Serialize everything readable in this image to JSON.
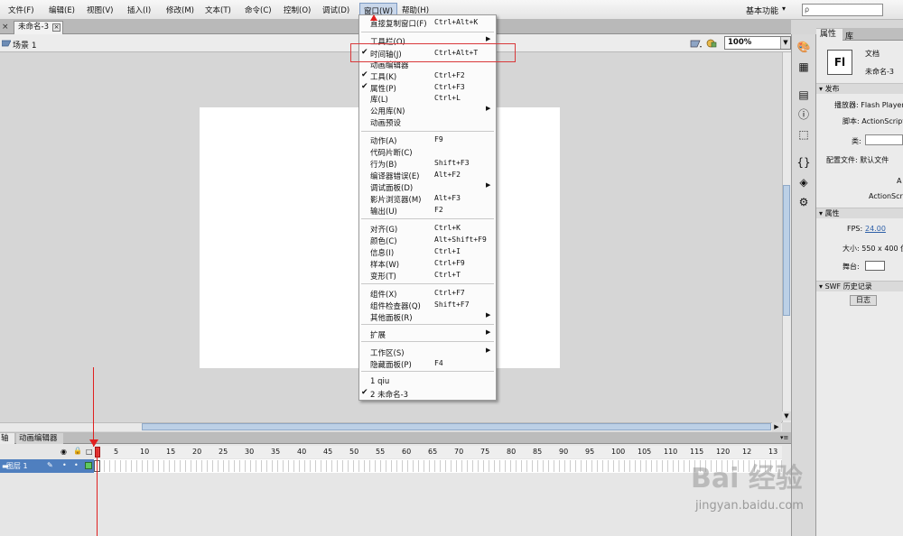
{
  "menubar": {
    "items": [
      {
        "label": "文件(F)"
      },
      {
        "label": "编辑(E)"
      },
      {
        "label": "视图(V)"
      },
      {
        "label": "插入(I)"
      },
      {
        "label": "修改(M)"
      },
      {
        "label": "文本(T)"
      },
      {
        "label": "命令(C)"
      },
      {
        "label": "控制(O)"
      },
      {
        "label": "调试(D)"
      },
      {
        "label": "窗口(W)"
      },
      {
        "label": "帮助(H)"
      }
    ],
    "workspace": "基本功能",
    "workspace_chevron": "▾",
    "search_icon": "ρ"
  },
  "document_tab": {
    "title": "未命名-3",
    "close": "×",
    "panel_close": "×"
  },
  "scene": {
    "label": "场景 1",
    "zoom": "100%"
  },
  "window_menu": {
    "items": [
      {
        "label": "直接复制窗口(F)",
        "shortcut": "Ctrl+Alt+K",
        "checked": false,
        "submenu": false
      },
      {
        "label": "工具栏(O)",
        "shortcut": "",
        "checked": false,
        "submenu": true
      },
      {
        "label": "时间轴(J)",
        "shortcut": "Ctrl+Alt+T",
        "checked": true,
        "submenu": false
      },
      {
        "label": "动画编辑器",
        "shortcut": "",
        "checked": false,
        "submenu": false
      },
      {
        "label": "工具(K)",
        "shortcut": "Ctrl+F2",
        "checked": true,
        "submenu": false
      },
      {
        "label": "属性(P)",
        "shortcut": "Ctrl+F3",
        "checked": true,
        "submenu": false
      },
      {
        "label": "库(L)",
        "shortcut": "Ctrl+L",
        "checked": false,
        "submenu": false
      },
      {
        "label": "公用库(N)",
        "shortcut": "",
        "checked": false,
        "submenu": true
      },
      {
        "label": "动画预设",
        "shortcut": "",
        "checked": false,
        "submenu": false
      },
      {
        "label": "动作(A)",
        "shortcut": "F9",
        "checked": false,
        "submenu": false
      },
      {
        "label": "代码片断(C)",
        "shortcut": "",
        "checked": false,
        "submenu": false
      },
      {
        "label": "行为(B)",
        "shortcut": "Shift+F3",
        "checked": false,
        "submenu": false
      },
      {
        "label": "编译器错误(E)",
        "shortcut": "Alt+F2",
        "checked": false,
        "submenu": false
      },
      {
        "label": "调试面板(D)",
        "shortcut": "",
        "checked": false,
        "submenu": true
      },
      {
        "label": "影片浏览器(M)",
        "shortcut": "Alt+F3",
        "checked": false,
        "submenu": false
      },
      {
        "label": "输出(U)",
        "shortcut": "F2",
        "checked": false,
        "submenu": false
      },
      {
        "label": "对齐(G)",
        "shortcut": "Ctrl+K",
        "checked": false,
        "submenu": false
      },
      {
        "label": "颜色(C)",
        "shortcut": "Alt+Shift+F9",
        "checked": false,
        "submenu": false
      },
      {
        "label": "信息(I)",
        "shortcut": "Ctrl+I",
        "checked": false,
        "submenu": false
      },
      {
        "label": "样本(W)",
        "shortcut": "Ctrl+F9",
        "checked": false,
        "submenu": false
      },
      {
        "label": "变形(T)",
        "shortcut": "Ctrl+T",
        "checked": false,
        "submenu": false
      },
      {
        "label": "组件(X)",
        "shortcut": "Ctrl+F7",
        "checked": false,
        "submenu": false
      },
      {
        "label": "组件检查器(Q)",
        "shortcut": "Shift+F7",
        "checked": false,
        "submenu": false
      },
      {
        "label": "其他面板(R)",
        "shortcut": "",
        "checked": false,
        "submenu": true
      },
      {
        "label": "扩展",
        "shortcut": "",
        "checked": false,
        "submenu": true
      },
      {
        "label": "工作区(S)",
        "shortcut": "",
        "checked": false,
        "submenu": true
      },
      {
        "label": "隐藏面板(P)",
        "shortcut": "F4",
        "checked": false,
        "submenu": false
      },
      {
        "label": "1 qiu",
        "shortcut": "",
        "checked": false,
        "submenu": false
      },
      {
        "label": "2 未命名-3",
        "shortcut": "",
        "checked": true,
        "submenu": false
      }
    ],
    "highlighted_item": "时间轴(J)"
  },
  "timeline": {
    "tabs": [
      "轴",
      "动画编辑器"
    ],
    "layer_name": "图层 1",
    "frame_ticks": [
      "5",
      "10",
      "15",
      "20",
      "25",
      "30",
      "35",
      "40",
      "45",
      "50",
      "55",
      "60",
      "65",
      "70",
      "75",
      "80",
      "85",
      "90",
      "95",
      "100",
      "105",
      "110",
      "115",
      "120",
      "12",
      "13"
    ],
    "current_frame": 1
  },
  "properties": {
    "tabs": [
      "属性",
      "库"
    ],
    "doc_type": "文档",
    "doc_name": "未命名-3",
    "fl_badge": "Fl",
    "publish_header": "发布",
    "player_label": "播放器: Flash Player",
    "script_label": "脚本: ActionScript",
    "class_label": "类:",
    "profile_label": "配置文件: 默认文件",
    "as_short": "A",
    "as_setting": "ActionScrip",
    "props_header": "属性",
    "fps_label": "FPS:",
    "fps_value": "24.00",
    "size_label": "大小: 550 x 400 像",
    "stage_label": "舞台:",
    "swf_header": "SWF 历史记录",
    "log_button": "日志"
  },
  "watermark": {
    "logo": "Bai 经验",
    "url": "jingyan.baidu.com"
  },
  "colors": {
    "highlight_box": "#d9383a",
    "layer_selected": "#4f7fbf",
    "playhead": "#e13b3b",
    "fps_link": "#2d5fa8"
  }
}
